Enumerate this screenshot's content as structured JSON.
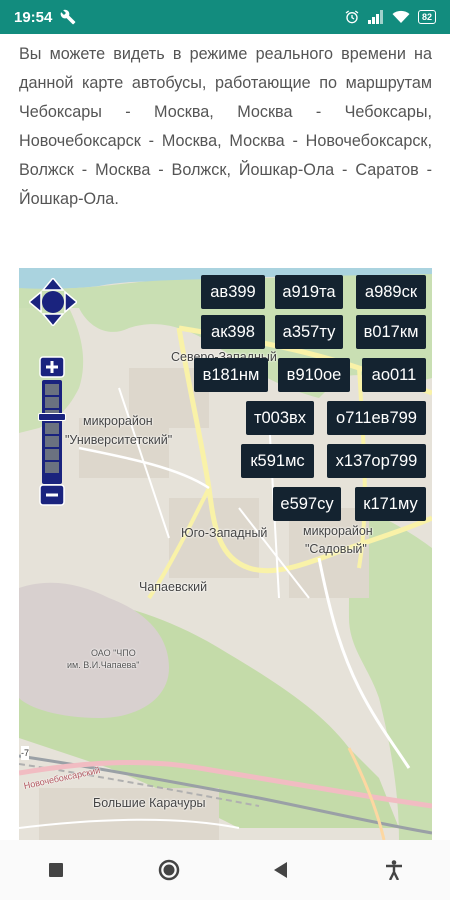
{
  "status_bar": {
    "time": "19:54",
    "icons": [
      "wrench-icon",
      "alarm-icon",
      "signal-icon",
      "wifi-icon",
      "battery-icon"
    ],
    "battery": "82"
  },
  "intro_text": "Вы можете видеть в режиме реального времени на данной карте автобусы, работающие по маршрутам Чебоксары - Москва, Москва - Чебоксары, Новочебоксарск - Москва, Москва - Новочебоксарск, Волжск - Москва - Волжск, Йошкар-Ола - Саратов - Йошкар-Ола.",
  "map": {
    "places": {
      "district_university_1": "микрорайон",
      "district_university_2": "\"Университетский\"",
      "severo_zapadny": "Северо-Западный",
      "yugo_zapadny": "Юго-Западный",
      "sadovy_1": "микрорайон",
      "sadovy_2": "\"Садовый\"",
      "chapaevsky": "Чапаевский",
      "chpo_1": "ОАО \"ЧПО",
      "chpo_2": "им. В.И.Чапаева\"",
      "bolshie_karachury": "Большие Карачуры",
      "novocheb_road": "Новочебоксарский",
      "road_number": "-7"
    },
    "buses": [
      [
        "ав399",
        "а919та",
        "а989ск"
      ],
      [
        "ак398",
        "а357ту",
        "в017км"
      ],
      [
        "в181нм",
        "в910ое",
        "ао011"
      ],
      [
        "т003вх",
        "о711ев799"
      ],
      [
        "к591мс",
        "х137ор799"
      ],
      [
        "е597су",
        "к171му"
      ]
    ],
    "controls": {
      "pan": "pan-control",
      "zoom_in": "+",
      "zoom_out": "−"
    }
  },
  "nav_bar": {
    "buttons": [
      "recents-button",
      "home-button",
      "back-button",
      "accessibility-button"
    ]
  },
  "colors": {
    "status_bar": "#128c7e",
    "bus_label_bg": "#142330",
    "map_control": "#1a237e"
  }
}
